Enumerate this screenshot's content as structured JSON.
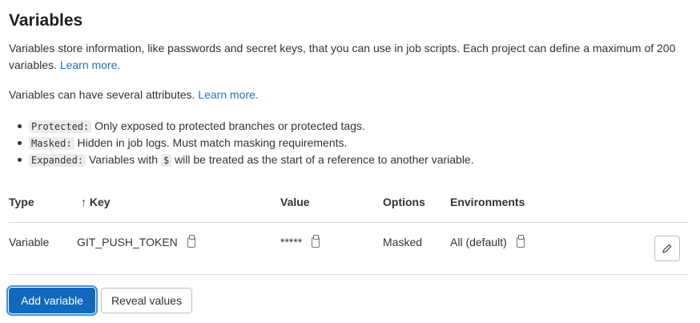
{
  "title": "Variables",
  "intro": {
    "text": "Variables store information, like passwords and secret keys, that you can use in job scripts. Each project can define a maximum of 200 variables.",
    "link": "Learn more."
  },
  "attributes": {
    "text": "Variables can have several attributes.",
    "link": "Learn more."
  },
  "bullets": [
    {
      "code": "Protected:",
      "text": "Only exposed to protected branches or protected tags."
    },
    {
      "code": "Masked:",
      "text": "Hidden in job logs. Must match masking requirements."
    },
    {
      "code": "Expanded:",
      "text": "Variables with",
      "code2": "$",
      "text2": "will be treated as the start of a reference to another variable."
    }
  ],
  "table": {
    "headers": {
      "type": "Type",
      "key": "Key",
      "sort_icon": "↑",
      "value": "Value",
      "options": "Options",
      "environments": "Environments"
    },
    "rows": [
      {
        "type": "Variable",
        "key": "GIT_PUSH_TOKEN",
        "value": "*****",
        "options": "Masked",
        "environment": "All (default)"
      }
    ]
  },
  "buttons": {
    "add": "Add variable",
    "reveal": "Reveal values"
  },
  "colors": {
    "primary": "#1068bf",
    "link": "#1f75cb"
  }
}
